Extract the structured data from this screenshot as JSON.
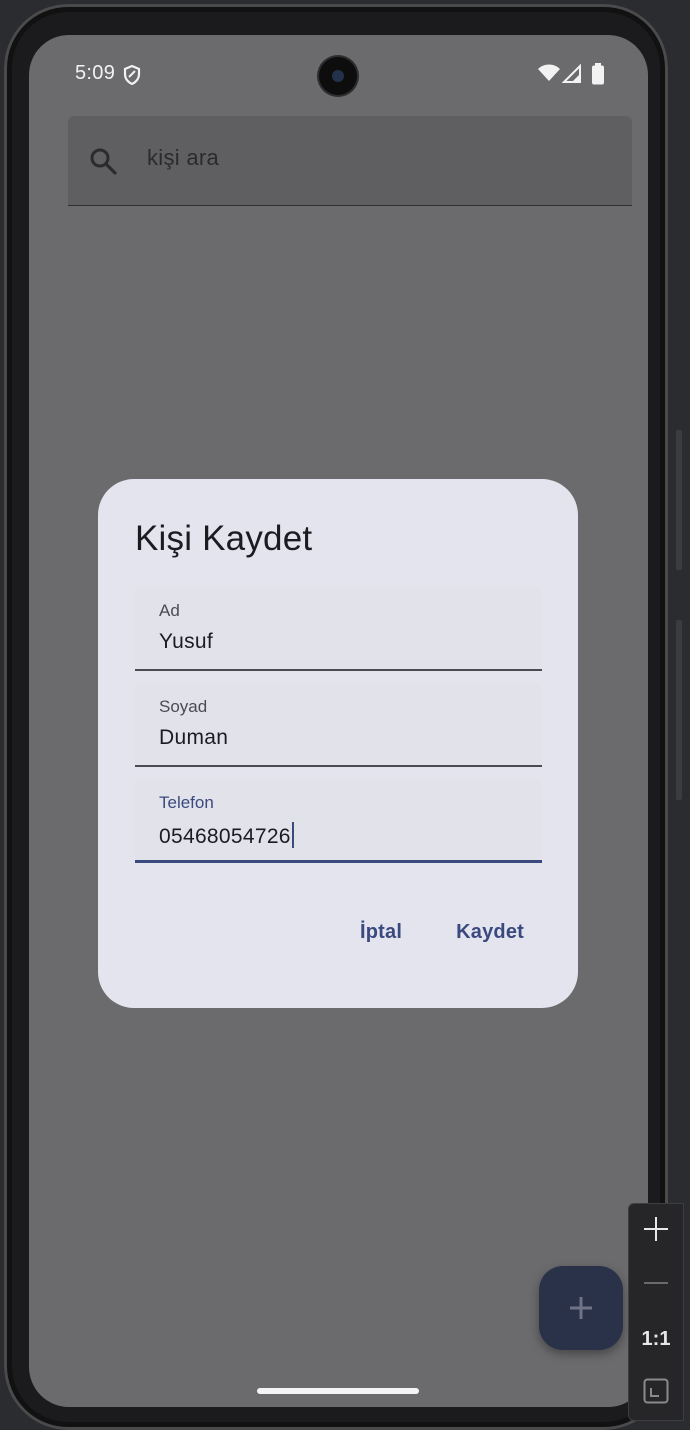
{
  "status_bar": {
    "time": "5:09",
    "icons": [
      "shield-icon",
      "wifi-icon",
      "signal-icon",
      "battery-icon"
    ]
  },
  "search": {
    "placeholder": "kişi ara",
    "icon": "search-icon"
  },
  "dialog": {
    "title": "Kişi Kaydet",
    "fields": [
      {
        "label": "Ad",
        "value": "Yusuf"
      },
      {
        "label": "Soyad",
        "value": "Duman"
      },
      {
        "label": "Telefon",
        "value": "05468054726"
      }
    ],
    "cancel_label": "İptal",
    "save_label": "Kaydet"
  },
  "fab": {
    "icon": "plus-icon"
  },
  "zoom_controls": {
    "zoom_in_icon": "plus-icon",
    "zoom_out_icon": "minus-icon",
    "actual_size_label": "1:1",
    "fit_icon": "fit-screen-icon"
  },
  "colors": {
    "accent": "#3a4a7f",
    "dialog_bg": "#e4e4ef",
    "scrim": "#6b6b6d",
    "fab_bg": "#2a3249"
  }
}
